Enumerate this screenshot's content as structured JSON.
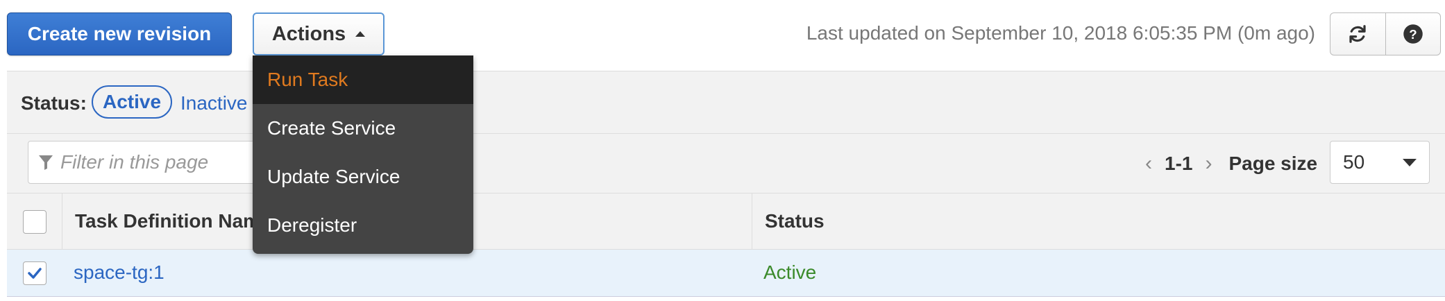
{
  "toolbar": {
    "create_revision_label": "Create new revision",
    "actions_label": "Actions",
    "last_updated": "Last updated on September 10, 2018 6:05:35 PM (0m ago)",
    "refresh_icon": "refresh-icon",
    "help_icon": "question-circle-icon"
  },
  "actions_menu": {
    "items": [
      {
        "label": "Run Task",
        "highlighted": true
      },
      {
        "label": "Create Service",
        "highlighted": false
      },
      {
        "label": "Update Service",
        "highlighted": false
      },
      {
        "label": "Deregister",
        "highlighted": false
      }
    ]
  },
  "status_filter": {
    "label": "Status:",
    "active_label": "Active",
    "inactive_label": "Inactive"
  },
  "filter": {
    "placeholder": "Filter in this page"
  },
  "pagination": {
    "range": "1-1",
    "page_size_label": "Page size",
    "page_size_value": "50"
  },
  "table": {
    "columns": [
      "Task Definition Name",
      "Status"
    ],
    "rows": [
      {
        "name": "space-tg:1",
        "status": "Active",
        "selected": true
      }
    ]
  },
  "colors": {
    "primary_button": "#2b66c2",
    "link": "#2b66c2",
    "menu_bg": "#444444",
    "menu_highlight_text": "#e07a1f",
    "status_active": "#3a8a2a",
    "selected_row_bg": "#e8f2fb"
  }
}
